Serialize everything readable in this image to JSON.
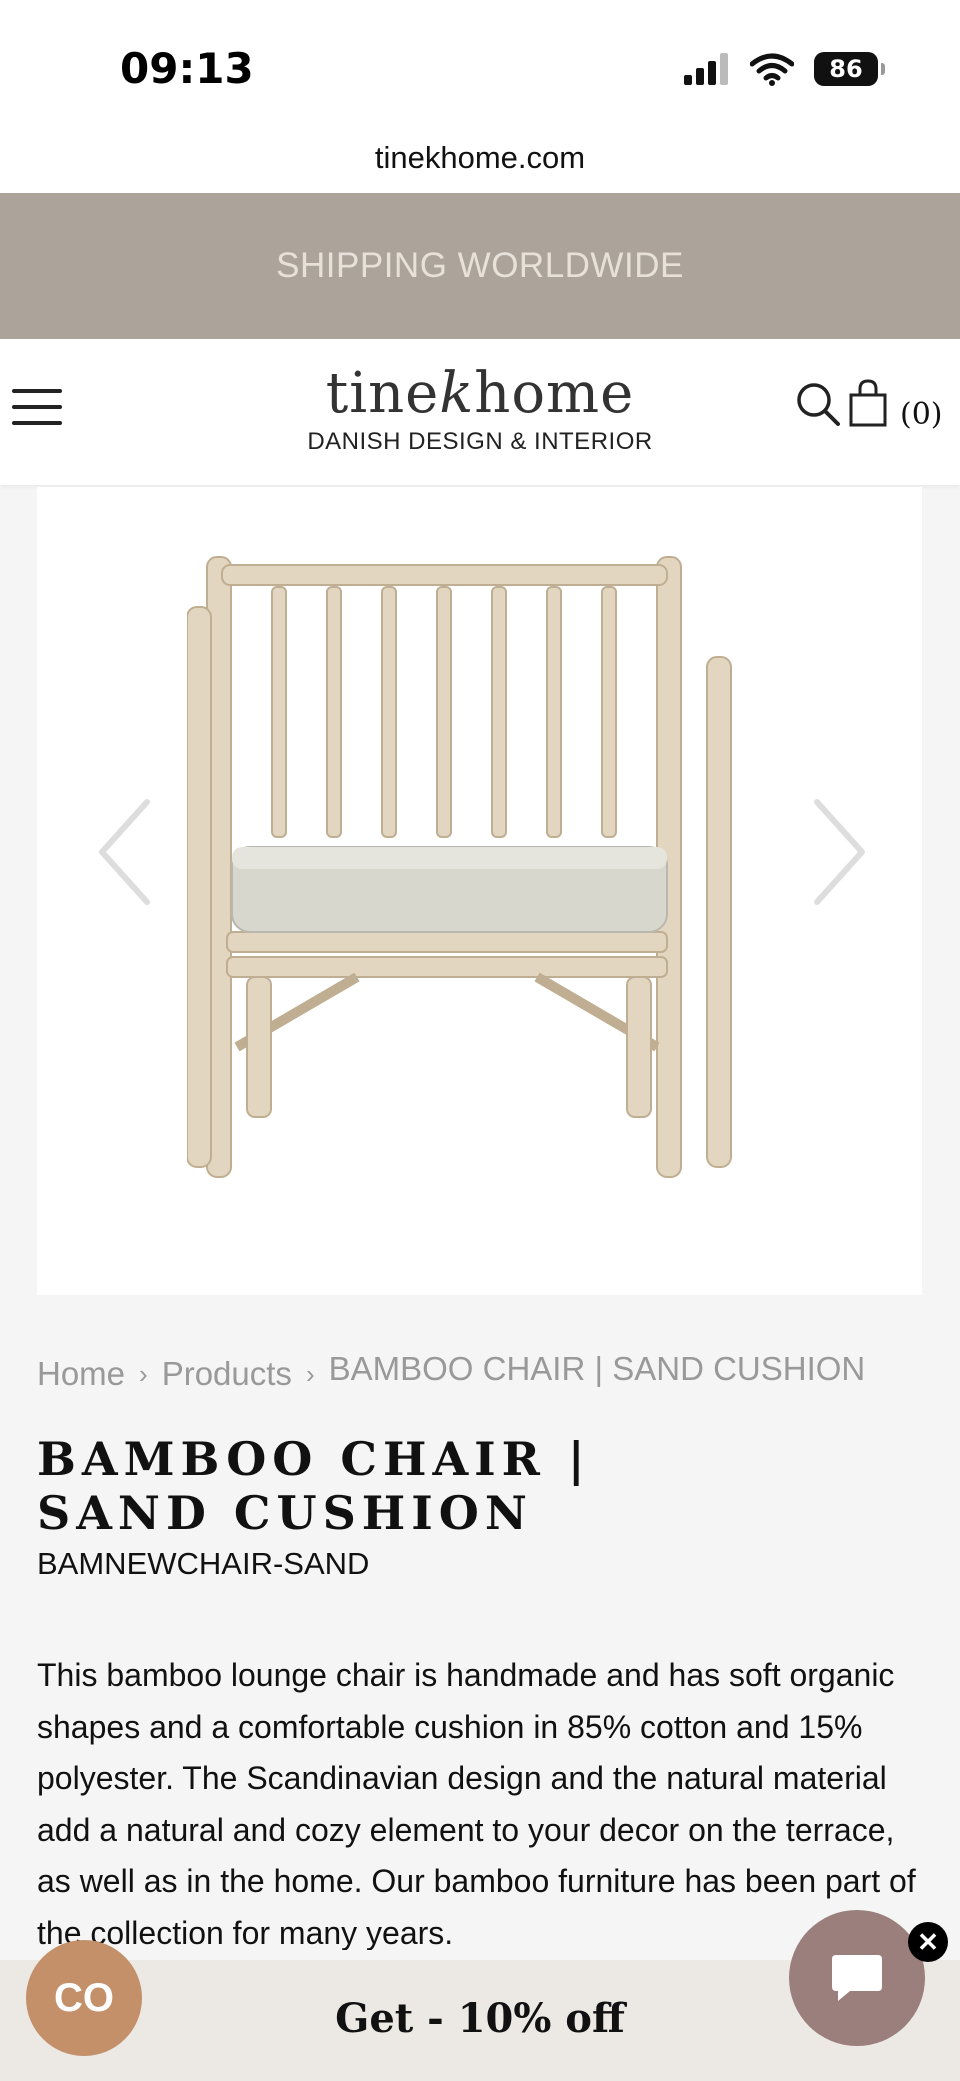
{
  "status_bar": {
    "time": "09:13",
    "battery": "86"
  },
  "browser": {
    "url": "tinekhome.com"
  },
  "promo_banner": {
    "text": "SHIPPING WORLDWIDE"
  },
  "header": {
    "logo_left": "tine",
    "logo_k": "k",
    "logo_right": "home",
    "tagline": "DANISH DESIGN & INTERIOR",
    "cart_count": "(0)"
  },
  "breadcrumb": {
    "home": "Home",
    "products": "Products",
    "current": "BAMBOO CHAIR | SAND CUSHION"
  },
  "product": {
    "title": "BAMBOO CHAIR | SAND CUSHION",
    "sku": "BAMNEWCHAIR-SAND",
    "description": "This bamboo lounge chair is handmade and has soft organic shapes and a comfortable cushion in 85% cotton and 15% polyester. The Scandinavian design and the natural material add a natural and cozy element to your decor on the terrace, as well as in the home. Our bamboo furniture has been part of the collection for many years."
  },
  "popup": {
    "discount": "Get - 10% off",
    "co_button": "CO",
    "close": "✕"
  },
  "colors": {
    "promo_bg": "#aca49b",
    "chat_bg": "#9a7f7c",
    "co_bg": "#c4906a"
  }
}
